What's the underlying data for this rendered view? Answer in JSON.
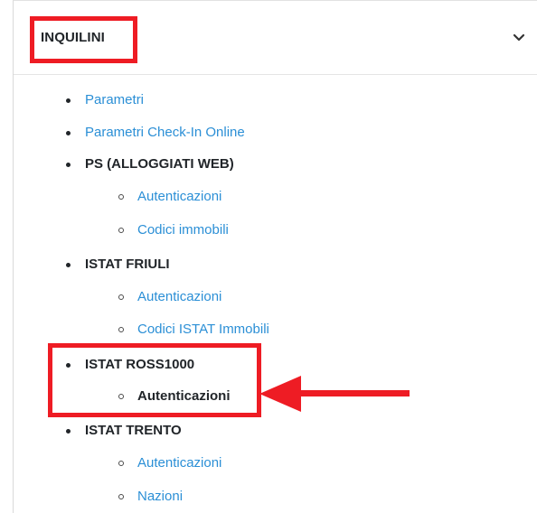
{
  "header": {
    "title": "INQUILINI",
    "toggle_icon": "chevron-down-icon"
  },
  "menu": {
    "items": [
      {
        "label": "Parametri",
        "type": "link"
      },
      {
        "label": "Parametri Check-In Online",
        "type": "link"
      },
      {
        "label": "PS (ALLOGGIATI WEB)",
        "type": "group",
        "children": [
          {
            "label": "Autenticazioni",
            "type": "link"
          },
          {
            "label": "Codici immobili",
            "type": "link"
          }
        ]
      },
      {
        "label": "ISTAT FRIULI",
        "type": "group",
        "children": [
          {
            "label": "Autenticazioni",
            "type": "link"
          },
          {
            "label": "Codici ISTAT Immobili",
            "type": "link"
          }
        ]
      },
      {
        "label": "ISTAT ROSS1000",
        "type": "group",
        "children": [
          {
            "label": "Autenticazioni",
            "type": "active"
          }
        ]
      },
      {
        "label": "ISTAT TRENTO",
        "type": "group",
        "children": [
          {
            "label": "Autenticazioni",
            "type": "link"
          },
          {
            "label": "Nazioni",
            "type": "link"
          }
        ]
      }
    ]
  },
  "colors": {
    "link": "#2b8fd6",
    "text": "#212529",
    "annotation": "#ee1c24"
  }
}
